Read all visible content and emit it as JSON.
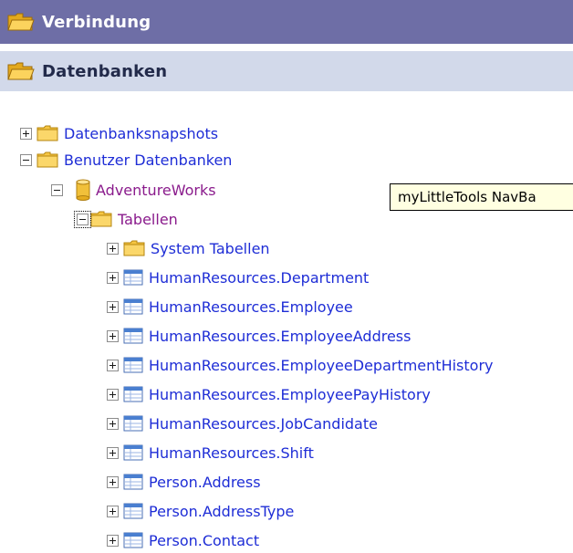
{
  "panels": {
    "verbindung": {
      "title": "Verbindung",
      "icon": "folder-open-icon"
    },
    "datenbanken": {
      "title": "Datenbanken",
      "icon": "folder-open-icon"
    }
  },
  "tree": {
    "datenbanksnapshots": {
      "label": "Datenbanksnapshots",
      "expander": "collapsed",
      "icon": "folder-icon"
    },
    "benutzer_datenbanken": {
      "label": "Benutzer Datenbanken",
      "expander": "expanded",
      "icon": "folder-icon"
    },
    "adventureworks": {
      "label": "AdventureWorks",
      "expander": "expanded",
      "icon": "database-icon"
    },
    "tabellen": {
      "label": "Tabellen",
      "expander": "expanded",
      "icon": "folder-icon"
    },
    "tables": [
      {
        "label": "System Tabellen",
        "icon": "folder-icon"
      },
      {
        "label": "HumanResources.Department",
        "icon": "table-icon"
      },
      {
        "label": "HumanResources.Employee",
        "icon": "table-icon"
      },
      {
        "label": "HumanResources.EmployeeAddress",
        "icon": "table-icon"
      },
      {
        "label": "HumanResources.EmployeeDepartmentHistory",
        "icon": "table-icon"
      },
      {
        "label": "HumanResources.EmployeePayHistory",
        "icon": "table-icon"
      },
      {
        "label": "HumanResources.JobCandidate",
        "icon": "table-icon"
      },
      {
        "label": "HumanResources.Shift",
        "icon": "table-icon"
      },
      {
        "label": "Person.Address",
        "icon": "table-icon"
      },
      {
        "label": "Person.AddressType",
        "icon": "table-icon"
      },
      {
        "label": "Person.Contact",
        "icon": "table-icon"
      }
    ]
  },
  "tooltip": {
    "text": "myLittleTools NavBa"
  },
  "colors": {
    "header_dark": "#6e6ea6",
    "header_light": "#d2d9ea",
    "link": "#1e2dd6",
    "link_visited": "#8a1b8c",
    "tooltip_bg": "#ffffe1"
  }
}
